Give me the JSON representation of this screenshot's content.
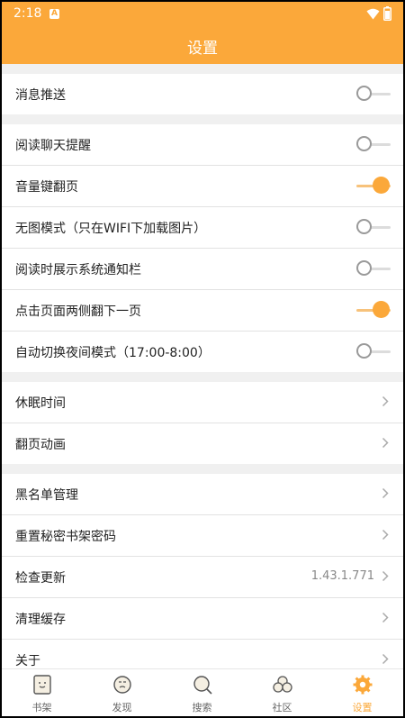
{
  "status_bar": {
    "time": "2:18",
    "notification_letter": "A",
    "wifi_icon": "wifi-icon",
    "battery_icon": "battery-icon"
  },
  "header": {
    "title": "设置"
  },
  "groups": [
    {
      "items": [
        {
          "label": "消息推送",
          "type": "toggle",
          "on": false
        }
      ]
    },
    {
      "items": [
        {
          "label": "阅读聊天提醒",
          "type": "toggle",
          "on": false
        },
        {
          "label": "音量键翻页",
          "type": "toggle",
          "on": true
        },
        {
          "label": "无图模式（只在WIFI下加载图片）",
          "type": "toggle",
          "on": false
        },
        {
          "label": "阅读时展示系统通知栏",
          "type": "toggle",
          "on": false
        },
        {
          "label": "点击页面两侧翻下一页",
          "type": "toggle",
          "on": true
        },
        {
          "label": "自动切换夜间模式（17:00-8:00）",
          "type": "toggle",
          "on": false
        }
      ]
    },
    {
      "items": [
        {
          "label": "休眠时间",
          "type": "link"
        },
        {
          "label": "翻页动画",
          "type": "link"
        }
      ]
    },
    {
      "items": [
        {
          "label": "黑名单管理",
          "type": "link"
        },
        {
          "label": "重置秘密书架密码",
          "type": "link"
        },
        {
          "label": "检查更新",
          "type": "link",
          "value": "1.43.1.771"
        },
        {
          "label": "清理缓存",
          "type": "link"
        },
        {
          "label": "关于",
          "type": "link"
        }
      ]
    }
  ],
  "tabs": [
    {
      "label": "书架",
      "icon": "bookshelf-icon",
      "active": false
    },
    {
      "label": "发现",
      "icon": "discover-icon",
      "active": false
    },
    {
      "label": "搜索",
      "icon": "search-icon",
      "active": false
    },
    {
      "label": "社区",
      "icon": "community-icon",
      "active": false
    },
    {
      "label": "设置",
      "icon": "settings-gear-icon",
      "active": true
    }
  ],
  "colors": {
    "accent": "#fba83a",
    "background": "#f0f0f0",
    "toggle_on_track": "#f7c27b"
  }
}
